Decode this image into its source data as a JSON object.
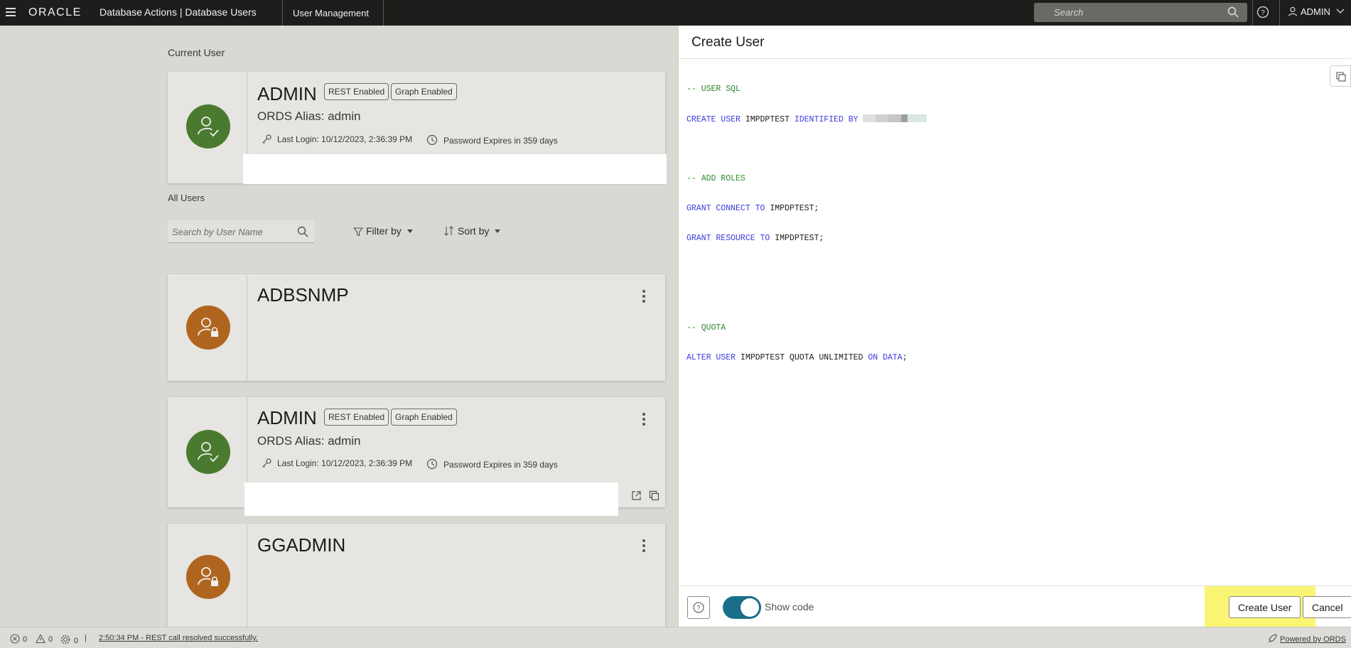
{
  "topbar": {
    "logo": "ORACLE",
    "app_title": "Database Actions |  Database Users",
    "tab": "User Management",
    "search_placeholder": "Search",
    "user": "ADMIN"
  },
  "current_user": {
    "section_label": "Current User",
    "name": "ADMIN",
    "badges": [
      "REST Enabled",
      "Graph Enabled"
    ],
    "alias": "ORDS Alias: admin",
    "last_login": "Last Login: 10/12/2023, 2:36:39 PM",
    "password_expiry": "Password Expires in 359 days"
  },
  "all_users": {
    "section_label": "All Users",
    "search_placeholder": "Search by User Name",
    "filter_label": "Filter by",
    "sort_label": "Sort by",
    "users": [
      {
        "name": "ADBSNMP",
        "status": "locked"
      },
      {
        "name": "ADMIN",
        "status": "active",
        "badges": [
          "REST Enabled",
          "Graph Enabled"
        ],
        "alias": "ORDS Alias: admin",
        "last_login": "Last Login: 10/12/2023, 2:36:39 PM",
        "password_expiry": "Password Expires in 359 days"
      },
      {
        "name": "GGADMIN",
        "status": "locked"
      }
    ]
  },
  "drawer": {
    "title": "Create User",
    "code": {
      "l1": "-- USER SQL",
      "l2_kw1": "CREATE USER",
      "l2_id": " IMPDPTEST ",
      "l2_kw2": "IDENTIFIED BY",
      "l4": "-- ADD ROLES",
      "l5_kw1": "GRANT CONNECT TO",
      "l5_id": " IMPDPTEST;",
      "l6_kw1": "GRANT RESOURCE TO",
      "l6_id": " IMPDPTEST;",
      "l9": "-- QUOTA",
      "l10_kw1": "ALTER USER",
      "l10_id": " IMPDPTEST QUOTA UNLIMITED ",
      "l10_kw2": "ON",
      "l10_id2": " ",
      "l10_kw3": "DATA",
      "l10_id3": ";"
    },
    "show_code_label": "Show code",
    "show_code_on": true,
    "create_button": "Create User",
    "cancel_button": "Cancel"
  },
  "statusbar": {
    "errors": "0",
    "warnings": "0",
    "tasks": "0",
    "separator": "|",
    "message": "2:50:34 PM - REST call resolved successfully.",
    "powered": "Powered by ORDS"
  },
  "colors": {
    "accent_toggle": "#1a6e8a",
    "avatar_active": "#4a7a2f",
    "avatar_locked": "#b0651f",
    "highlight": "#f9f35a"
  }
}
